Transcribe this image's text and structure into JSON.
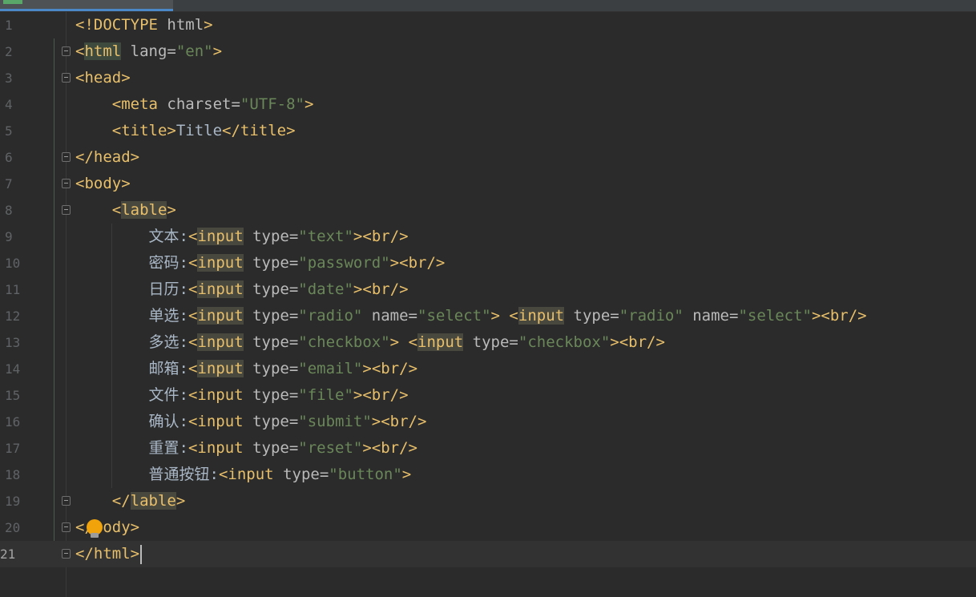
{
  "editor": {
    "lines": [
      {
        "number": "1",
        "segments": [
          [
            "t",
            "<!DOCTYPE "
          ],
          [
            "a",
            "html"
          ],
          [
            "t",
            ">"
          ]
        ]
      },
      {
        "number": "2",
        "segments": [
          [
            "t",
            "<"
          ],
          [
            "t hl2",
            "html"
          ],
          [
            "a",
            " lang="
          ],
          [
            "v",
            "\"en\""
          ],
          [
            "t",
            ">"
          ]
        ]
      },
      {
        "number": "3",
        "segments": [
          [
            "t",
            "<head>"
          ]
        ]
      },
      {
        "number": "4",
        "segments": [
          [
            "p",
            "    "
          ],
          [
            "t",
            "<meta "
          ],
          [
            "a",
            "charset="
          ],
          [
            "v",
            "\"UTF-8\""
          ],
          [
            "t",
            ">"
          ]
        ]
      },
      {
        "number": "5",
        "segments": [
          [
            "p",
            "    "
          ],
          [
            "t",
            "<title>"
          ],
          [
            "p",
            "Title"
          ],
          [
            "t",
            "</title>"
          ]
        ]
      },
      {
        "number": "6",
        "segments": [
          [
            "t",
            "</head>"
          ]
        ]
      },
      {
        "number": "7",
        "segments": [
          [
            "t",
            "<body>"
          ]
        ]
      },
      {
        "number": "8",
        "segments": [
          [
            "p",
            "    "
          ],
          [
            "t",
            "<"
          ],
          [
            "t hl",
            "lable"
          ],
          [
            "t",
            ">"
          ]
        ]
      },
      {
        "number": "9",
        "segments": [
          [
            "p",
            "        "
          ],
          [
            "cn",
            "文本"
          ],
          [
            "p",
            ":"
          ],
          [
            "t",
            "<"
          ],
          [
            "t hl",
            "input"
          ],
          [
            "a",
            " type="
          ],
          [
            "v",
            "\"text\""
          ],
          [
            "t",
            ">"
          ],
          [
            "t",
            "<br/>"
          ]
        ]
      },
      {
        "number": "10",
        "segments": [
          [
            "p",
            "        "
          ],
          [
            "cn",
            "密码"
          ],
          [
            "p",
            ":"
          ],
          [
            "t",
            "<"
          ],
          [
            "t hl",
            "input"
          ],
          [
            "a",
            " type="
          ],
          [
            "v",
            "\"password\""
          ],
          [
            "t",
            ">"
          ],
          [
            "t",
            "<br/>"
          ]
        ]
      },
      {
        "number": "11",
        "segments": [
          [
            "p",
            "        "
          ],
          [
            "cn",
            "日历"
          ],
          [
            "p",
            ":"
          ],
          [
            "t",
            "<"
          ],
          [
            "t hl",
            "input"
          ],
          [
            "a",
            " type="
          ],
          [
            "v",
            "\"date\""
          ],
          [
            "t",
            ">"
          ],
          [
            "t",
            "<br/>"
          ]
        ]
      },
      {
        "number": "12",
        "segments": [
          [
            "p",
            "        "
          ],
          [
            "cn",
            "单选"
          ],
          [
            "p",
            ":"
          ],
          [
            "t",
            "<"
          ],
          [
            "t hl",
            "input"
          ],
          [
            "a",
            " type="
          ],
          [
            "v",
            "\"radio\""
          ],
          [
            "a",
            " name="
          ],
          [
            "v",
            "\"select\""
          ],
          [
            "t",
            ">"
          ],
          [
            "p",
            " "
          ],
          [
            "t",
            "<"
          ],
          [
            "t hl",
            "input"
          ],
          [
            "a",
            " type="
          ],
          [
            "v",
            "\"radio\""
          ],
          [
            "a",
            " name="
          ],
          [
            "v",
            "\"select\""
          ],
          [
            "t",
            ">"
          ],
          [
            "t",
            "<br/>"
          ]
        ]
      },
      {
        "number": "13",
        "segments": [
          [
            "p",
            "        "
          ],
          [
            "cn",
            "多选"
          ],
          [
            "p",
            ":"
          ],
          [
            "t",
            "<"
          ],
          [
            "t hl",
            "input"
          ],
          [
            "a",
            " type="
          ],
          [
            "v",
            "\"checkbox\""
          ],
          [
            "t",
            ">"
          ],
          [
            "p",
            " "
          ],
          [
            "t",
            "<"
          ],
          [
            "t hl",
            "input"
          ],
          [
            "a",
            " type="
          ],
          [
            "v",
            "\"checkbox\""
          ],
          [
            "t",
            ">"
          ],
          [
            "t",
            "<br/>"
          ]
        ]
      },
      {
        "number": "14",
        "segments": [
          [
            "p",
            "        "
          ],
          [
            "cn",
            "邮箱"
          ],
          [
            "p",
            ":"
          ],
          [
            "t",
            "<"
          ],
          [
            "t hl",
            "input"
          ],
          [
            "a",
            " type="
          ],
          [
            "v",
            "\"email\""
          ],
          [
            "t",
            ">"
          ],
          [
            "t",
            "<br/>"
          ]
        ]
      },
      {
        "number": "15",
        "segments": [
          [
            "p",
            "        "
          ],
          [
            "cn",
            "文件"
          ],
          [
            "p",
            ":"
          ],
          [
            "t",
            "<input"
          ],
          [
            "a",
            " type="
          ],
          [
            "v",
            "\"file\""
          ],
          [
            "t",
            ">"
          ],
          [
            "t",
            "<br/>"
          ]
        ]
      },
      {
        "number": "16",
        "segments": [
          [
            "p",
            "        "
          ],
          [
            "cn",
            "确认"
          ],
          [
            "p",
            ":"
          ],
          [
            "t",
            "<input"
          ],
          [
            "a",
            " type="
          ],
          [
            "v",
            "\"submit\""
          ],
          [
            "t",
            ">"
          ],
          [
            "t",
            "<br/>"
          ]
        ]
      },
      {
        "number": "17",
        "segments": [
          [
            "p",
            "        "
          ],
          [
            "cn",
            "重置"
          ],
          [
            "p",
            ":"
          ],
          [
            "t",
            "<input"
          ],
          [
            "a",
            " type="
          ],
          [
            "v",
            "\"reset\""
          ],
          [
            "t",
            ">"
          ],
          [
            "t",
            "<br/>"
          ]
        ]
      },
      {
        "number": "18",
        "segments": [
          [
            "p",
            "        "
          ],
          [
            "cn",
            "普通按钮"
          ],
          [
            "p",
            ":"
          ],
          [
            "t",
            "<input"
          ],
          [
            "a",
            " type="
          ],
          [
            "v",
            "\"button\""
          ],
          [
            "t",
            ">"
          ]
        ]
      },
      {
        "number": "19",
        "segments": [
          [
            "p",
            "    "
          ],
          [
            "t",
            "</"
          ],
          [
            "t hl",
            "lable"
          ],
          [
            "t",
            ">"
          ]
        ]
      },
      {
        "number": "20",
        "segments": [
          [
            "t",
            "</body>"
          ]
        ]
      },
      {
        "number": "21",
        "segments": [
          [
            "t",
            "</html>"
          ]
        ]
      }
    ],
    "fold_markers": {
      "2": "start",
      "3": "start",
      "6": "end",
      "7": "start",
      "8": "start",
      "19": "end",
      "20": "end",
      "21": "end"
    },
    "caret_line": "21",
    "colors": {
      "tag": "#e8bf6a",
      "attr": "#bababa",
      "string": "#6a8759",
      "text": "#a9b7c6",
      "background": "#2b2b2b"
    }
  }
}
